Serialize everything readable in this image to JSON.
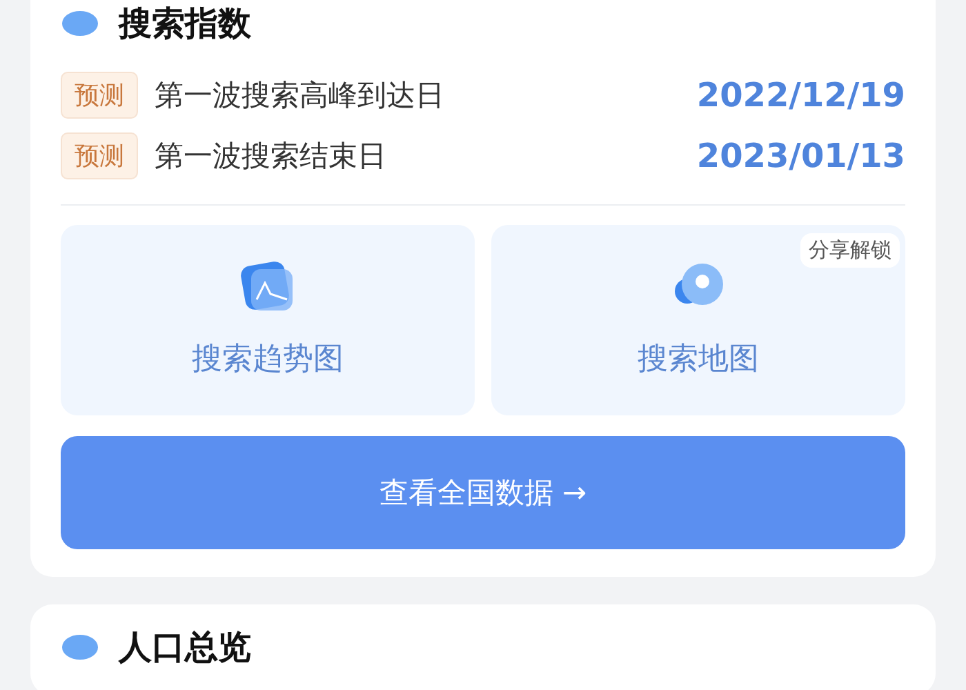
{
  "search_index": {
    "title": "搜索指数",
    "forecasts": [
      {
        "tag": "预测",
        "label": "第一波搜索高峰到达日",
        "date": "2022/12/19"
      },
      {
        "tag": "预测",
        "label": "第一波搜索结束日",
        "date": "2023/01/13"
      }
    ],
    "tiles": [
      {
        "kind": "trend",
        "label": "搜索趋势图"
      },
      {
        "kind": "map",
        "label": "搜索地图",
        "badge": "分享解锁"
      }
    ],
    "button": "查看全国数据 →"
  },
  "population": {
    "title": "人口总览"
  }
}
